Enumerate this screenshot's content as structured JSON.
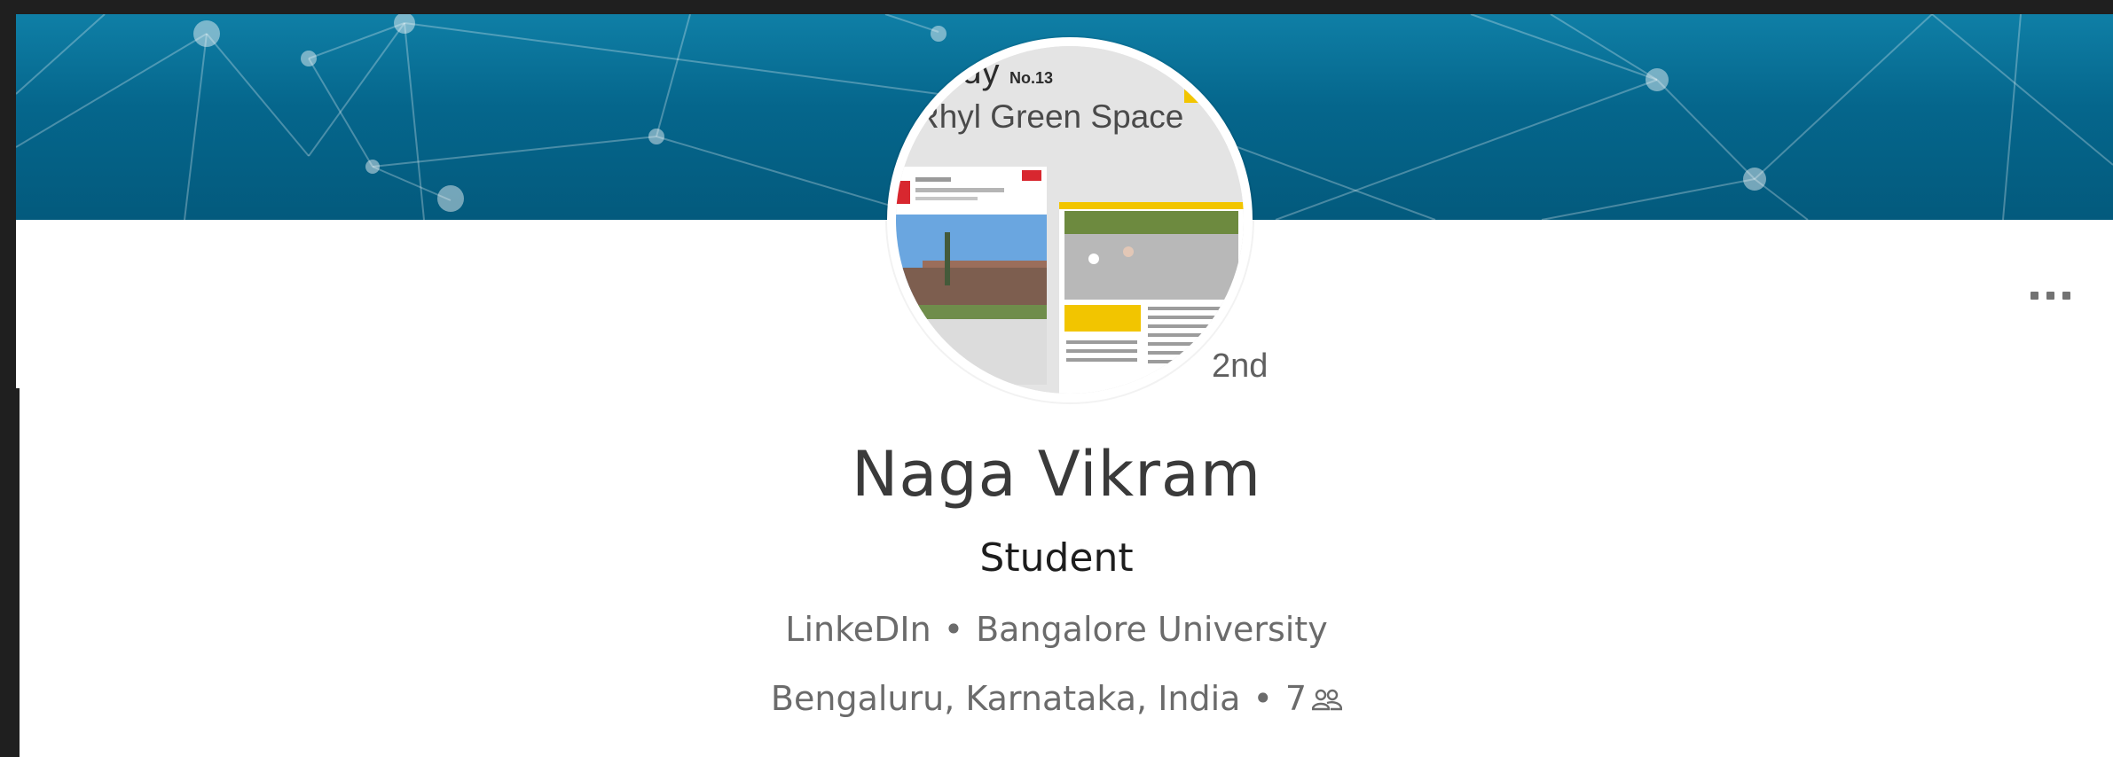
{
  "profile": {
    "name": "Naga Vikram",
    "headline": "Student",
    "degree": "2nd",
    "company": "LinkeDIn",
    "school": "Bangalore University",
    "location": "Bengaluru, Karnataka, India",
    "connections": "7",
    "separator": "•"
  },
  "avatar": {
    "image_title": "Rhyl Green Space",
    "image_subtitle": "No.13",
    "image_title_prefix": "udy"
  },
  "icons": {
    "more": "more-options-icon",
    "connections": "connections-icon"
  },
  "colors": {
    "banner": "#05668c",
    "card": "#ffffff",
    "background": "#1f1f1f",
    "muted_text": "#6b6b6b"
  }
}
